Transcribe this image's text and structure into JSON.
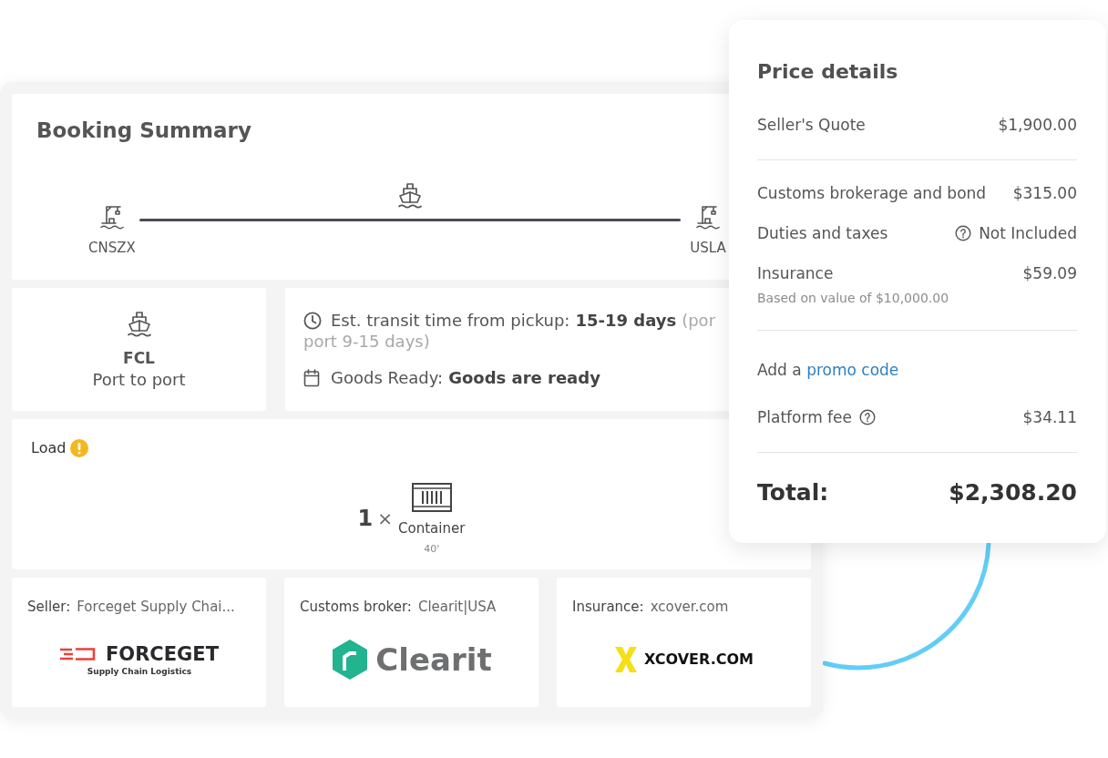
{
  "booking_summary": {
    "title": "Booking Summary",
    "route": {
      "origin": "CNSZX",
      "destination": "USLA"
    },
    "mode": {
      "type": "FCL",
      "service": "Port to port"
    },
    "schedule": {
      "transit_label": "Est. transit time from pickup:",
      "transit_value": "15-19 days",
      "transit_note_lines": [
        "(por",
        "port 9-15 days)"
      ],
      "ready_label": "Goods Ready:",
      "ready_value": "Goods are ready"
    },
    "load": {
      "title": "Load",
      "warning": true,
      "quantity": "1",
      "multiplier": "×",
      "unit": "Container",
      "size": "40'"
    },
    "parties": [
      {
        "role": "Seller:",
        "name": "Forceget Supply Chai...",
        "logo": {
          "kind": "speedlines",
          "wordmark": "FORCEGET",
          "tagline": "Supply Chain Logistics"
        }
      },
      {
        "role": "Customs broker:",
        "name": "Clearit|USA",
        "logo": {
          "kind": "hexagon",
          "wordmark": "Clearit"
        }
      },
      {
        "role": "Insurance:",
        "name": "xcover.com",
        "logo": {
          "kind": "crossmark",
          "wordmark": "XCOVER.COM"
        }
      }
    ]
  },
  "price_details": {
    "title": "Price details",
    "sections": [
      {
        "rows": [
          {
            "kind": "amount",
            "label": "Seller's Quote",
            "value": "$1,900.00",
            "label_help": false,
            "value_help": false
          }
        ]
      },
      {
        "rows": [
          {
            "kind": "amount",
            "label": "Customs brokerage and bond",
            "value": "$315.00",
            "label_help": false,
            "value_help": false
          },
          {
            "kind": "amount",
            "label": "Duties and taxes",
            "value": "Not Included",
            "label_help": false,
            "value_help": true
          },
          {
            "kind": "amount",
            "label": "Insurance",
            "value": "$59.09",
            "label_help": false,
            "value_help": false,
            "note": "Based on value of $10,000.00"
          }
        ]
      },
      {
        "rows": [
          {
            "kind": "promo",
            "text": "Add a",
            "link": "promo code"
          },
          {
            "kind": "amount",
            "label": "Platform fee",
            "value": "$34.11",
            "label_help": true,
            "value_help": false
          }
        ]
      }
    ],
    "total": {
      "label": "Total:",
      "value": "$2,308.20"
    }
  }
}
